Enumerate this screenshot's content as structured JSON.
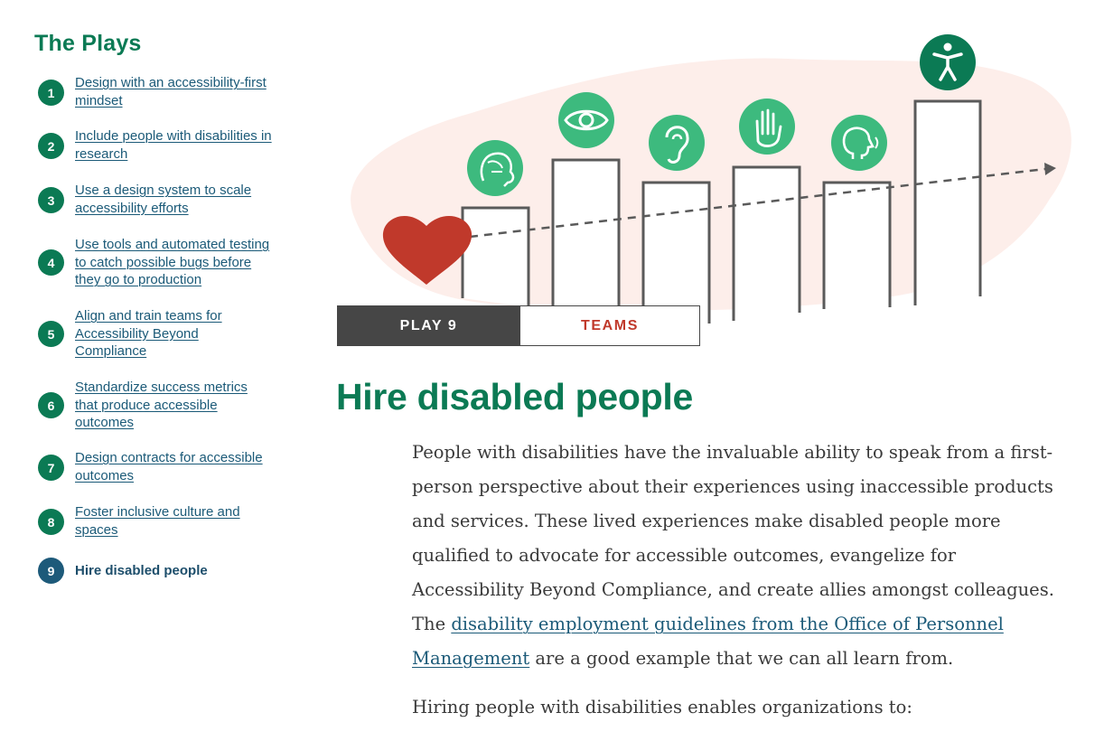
{
  "sidebar": {
    "title": "The Plays",
    "items": [
      {
        "num": "1",
        "label": "Design with an accessibility-first mindset"
      },
      {
        "num": "2",
        "label": "Include people with disabilities in research"
      },
      {
        "num": "3",
        "label": "Use a design system to scale accessibility efforts"
      },
      {
        "num": "4",
        "label": "Use tools and automated testing to catch possible bugs before they go to production"
      },
      {
        "num": "5",
        "label": "Align and train teams for Accessibility Beyond Compliance"
      },
      {
        "num": "6",
        "label": "Standardize success metrics that produce accessible outcomes"
      },
      {
        "num": "7",
        "label": "Design contracts for accessible outcomes"
      },
      {
        "num": "8",
        "label": "Foster inclusive culture and spaces"
      },
      {
        "num": "9",
        "label": "Hire disabled people",
        "current": true
      }
    ]
  },
  "banner": {
    "play_label": "PLAY 9",
    "team_label": "TEAMS"
  },
  "main": {
    "title": "Hire disabled people",
    "para1_text": "People with disabilities have the invaluable ability to speak from a first-person perspective about their experiences using inaccessible products and services. These lived experiences make disabled people more qualified to advocate for accessible outcomes, evangelize for Accessibility Beyond Compliance, and create allies amongst colleagues. The ",
    "para1_link": "disability employment guidelines from the Office of Personnel Management",
    "para1_tail": " are a good example that we can all learn from.",
    "para2_text": "Hiring people with disabilities enables organizations to:"
  },
  "colors": {
    "brand_green": "#0b7a54",
    "icon_green": "#3dba7e",
    "heart_red": "#c0392b",
    "link_blue": "#1b5a78",
    "current_blue": "#1d5a7a",
    "banner_dark": "#464646",
    "blob_pink": "#fdeeea"
  },
  "illustration": {
    "icons": [
      "brain-icon",
      "eye-icon",
      "ear-icon",
      "hand-icon",
      "speech-head-icon",
      "accessibility-person-icon",
      "heart-icon"
    ]
  }
}
